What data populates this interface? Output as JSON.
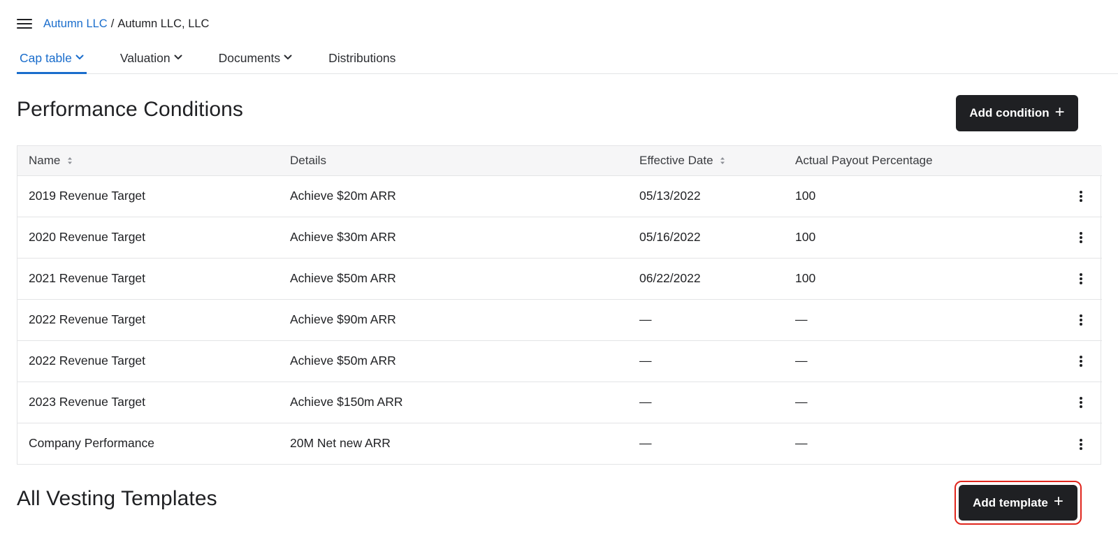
{
  "breadcrumb": {
    "parent": "Autumn LLC",
    "separator": "/",
    "current": "Autumn LLC, LLC"
  },
  "nav": {
    "tabs": [
      {
        "label": "Cap table",
        "active": true,
        "has_dropdown": true
      },
      {
        "label": "Valuation",
        "active": false,
        "has_dropdown": true
      },
      {
        "label": "Documents",
        "active": false,
        "has_dropdown": true
      },
      {
        "label": "Distributions",
        "active": false,
        "has_dropdown": false
      }
    ]
  },
  "performance": {
    "title": "Performance Conditions",
    "add_button": "Add condition",
    "columns": {
      "name": "Name",
      "details": "Details",
      "effective_date": "Effective Date",
      "payout": "Actual Payout Percentage"
    },
    "rows": [
      {
        "name": "2019 Revenue Target",
        "details": "Achieve $20m ARR",
        "effective_date": "05/13/2022",
        "payout": "100"
      },
      {
        "name": "2020 Revenue Target",
        "details": "Achieve $30m ARR",
        "effective_date": "05/16/2022",
        "payout": "100"
      },
      {
        "name": "2021 Revenue Target",
        "details": "Achieve $50m ARR",
        "effective_date": "06/22/2022",
        "payout": "100"
      },
      {
        "name": "2022 Revenue Target",
        "details": "Achieve $90m ARR",
        "effective_date": "—",
        "payout": "—"
      },
      {
        "name": "2022 Revenue Target",
        "details": "Achieve $50m ARR",
        "effective_date": "—",
        "payout": "—"
      },
      {
        "name": "2023 Revenue Target",
        "details": "Achieve $150m ARR",
        "effective_date": "—",
        "payout": "—"
      },
      {
        "name": "Company Performance",
        "details": "20M Net new ARR",
        "effective_date": "—",
        "payout": "—"
      }
    ]
  },
  "vesting": {
    "title": "All Vesting Templates",
    "add_button": "Add template"
  },
  "colors": {
    "accent": "#1a6dcc",
    "button_dark": "#1f2023",
    "focus_ring": "#e0261d"
  },
  "icons": {
    "menu": "hamburger-icon",
    "dropdown": "chevron-down-icon",
    "sort": "sort-icon",
    "row_actions": "kebab-icon",
    "add": "plus-icon"
  }
}
